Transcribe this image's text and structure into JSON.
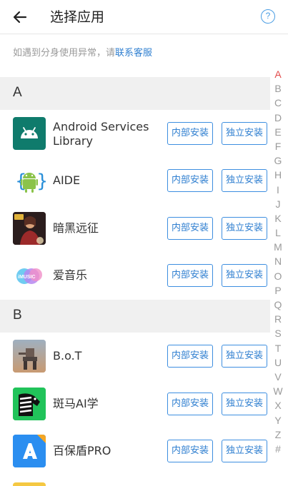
{
  "header": {
    "title": "选择应用",
    "help_label": "?"
  },
  "notice": {
    "text": "如遇到分身使用异常，请",
    "link": "联系客服"
  },
  "sections": [
    {
      "letter": "A",
      "apps": [
        {
          "name": "Android Services Library",
          "icon": "android-robot-icon"
        },
        {
          "name": "AIDE",
          "icon": "aide-android-icon"
        },
        {
          "name": "暗黑远征",
          "icon": "game-character-icon"
        },
        {
          "name": "爱音乐",
          "icon": "imusic-icon"
        }
      ]
    },
    {
      "letter": "B",
      "apps": [
        {
          "name": "B.o.T",
          "icon": "bot-mech-icon"
        },
        {
          "name": "斑马AI学",
          "icon": "zebra-icon"
        },
        {
          "name": "百保盾PRO",
          "icon": "shield-a-icon"
        }
      ]
    }
  ],
  "buttons": {
    "internal_install": "内部安装",
    "standalone_install": "独立安装"
  },
  "alphabet": [
    "A",
    "B",
    "C",
    "D",
    "E",
    "F",
    "G",
    "H",
    "I",
    "J",
    "K",
    "L",
    "M",
    "N",
    "O",
    "P",
    "Q",
    "R",
    "S",
    "T",
    "U",
    "V",
    "W",
    "X",
    "Y",
    "Z",
    "#"
  ],
  "alphabet_active": "A",
  "colors": {
    "accent": "#2f7fd0",
    "active_letter": "#e24b4b",
    "section_bg": "#f0f0f0"
  }
}
